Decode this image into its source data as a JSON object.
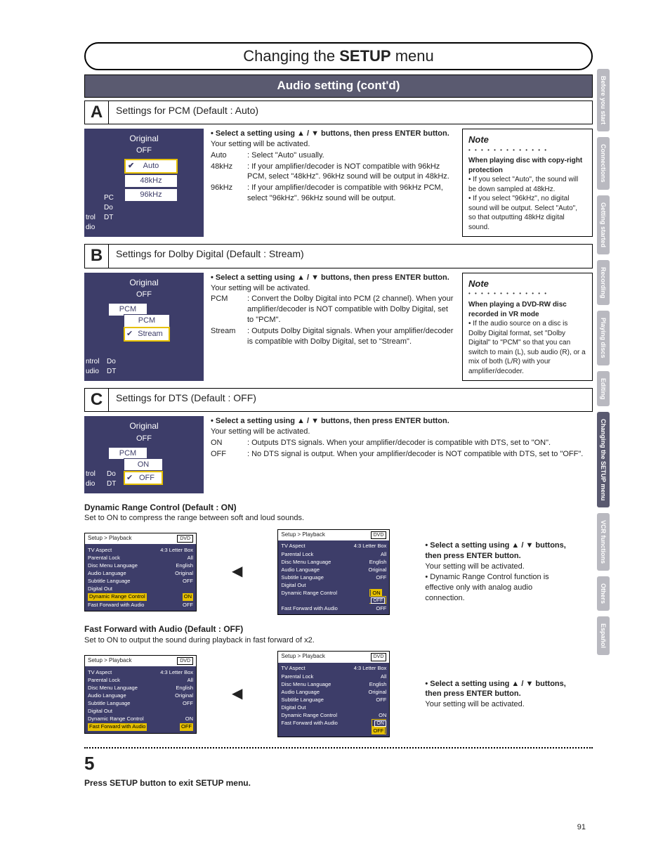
{
  "title_a": "Changing the ",
  "title_b": "SETUP",
  "title_c": " menu",
  "subtitle": "Audio setting (cont'd)",
  "sideTabs": [
    "Before you start",
    "Connections",
    "Getting started",
    "Recording",
    "Playing discs",
    "Editing",
    "Changing the SETUP menu",
    "VCR functions",
    "Others",
    "Español"
  ],
  "activeTab": "Changing the SETUP menu",
  "A": {
    "title": "Settings for PCM (Default : Auto)",
    "osd": {
      "hdr": "Original",
      "off": "OFF",
      "items": [
        "Auto",
        "48kHz",
        "96kHz"
      ],
      "selected": "Auto",
      "leftLabels": [
        "trol",
        "dio"
      ],
      "leftPrefix": [
        "PC",
        "Do",
        "DT"
      ]
    },
    "desc": {
      "lead": "• Select a setting using ▲ / ▼ buttons, then press ENTER button.",
      "line": "Your setting will be activated.",
      "opts": [
        {
          "l": "Auto",
          "t": ": Select \"Auto\" usually."
        },
        {
          "l": "48kHz",
          "t": ": If your amplifier/decoder is NOT compatible with 96kHz PCM, select \"48kHz\". 96kHz sound will be output in 48kHz."
        },
        {
          "l": "96kHz",
          "t": ": If your amplifier/decoder is compatible with 96kHz PCM, select \"96kHz\". 96kHz sound will be output."
        }
      ]
    },
    "note": {
      "h": "Note",
      "sub": "When playing disc with copy-right protection",
      "body": "• If you select \"Auto\", the sound will be down sampled at 48kHz.\n• If you select \"96kHz\", no digital sound will be output. Select \"Auto\", so that outputting 48kHz digital sound."
    }
  },
  "B": {
    "title": "Settings for Dolby Digital (Default : Stream)",
    "osd": {
      "hdr": "Original",
      "off": "OFF",
      "layer0": "PCM",
      "items": [
        "PCM",
        "Stream"
      ],
      "selected": "Stream",
      "leftLabels": [
        "ntrol",
        "udio"
      ],
      "leftPrefix": [
        "Do",
        "DT"
      ]
    },
    "desc": {
      "lead": "• Select a setting using ▲ / ▼ buttons, then press ENTER button.",
      "line": "Your setting will be activated.",
      "opts": [
        {
          "l": "PCM",
          "t": ": Convert the Dolby Digital into PCM (2 channel). When your amplifier/decoder is NOT compatible with Dolby Digital, set to \"PCM\"."
        },
        {
          "l": "Stream",
          "t": ": Outputs Dolby Digital signals. When your amplifier/decoder is compatible with Dolby Digital, set to \"Stream\"."
        }
      ]
    },
    "note": {
      "h": "Note",
      "sub": "When playing a DVD-RW disc recorded in VR mode",
      "body": "• If the audio source on a disc is Dolby Digital format, set \"Dolby Digital\" to \"PCM\" so that you can switch to main (L), sub audio (R), or a mix of both (L/R) with your amplifier/decoder."
    }
  },
  "C": {
    "title": "Settings for DTS (Default : OFF)",
    "osd": {
      "hdr": "Original",
      "off": "OFF",
      "layer0": "PCM",
      "items": [
        "ON",
        "OFF"
      ],
      "selected": "OFF",
      "leftLabels": [
        "trol",
        "dio"
      ],
      "leftPrefix": [
        "Do",
        "DT"
      ]
    },
    "desc": {
      "lead": "• Select a setting using ▲ / ▼ buttons, then press ENTER button.",
      "line": "Your setting will be activated.",
      "opts": [
        {
          "l": "ON",
          "t": ": Outputs DTS signals. When your amplifier/decoder is compatible with DTS, set to \"ON\"."
        },
        {
          "l": "OFF",
          "t": ": No DTS signal is output. When your amplifier/decoder is NOT compatible with DTS, set to \"OFF\"."
        }
      ]
    }
  },
  "drc": {
    "head": "Dynamic Range Control (Default : ON)",
    "sub": "Set to ON to compress the range between soft and loud sounds.",
    "menuPath": "Setup > Playback",
    "rows": [
      {
        "l": "TV Aspect",
        "v": "4:3 Letter Box"
      },
      {
        "l": "Parental Lock",
        "v": "All"
      },
      {
        "l": "Disc Menu Language",
        "v": "English"
      },
      {
        "l": "Audio Language",
        "v": "Original"
      },
      {
        "l": "Subtitle Language",
        "v": "OFF"
      },
      {
        "l": "Digital Out",
        "v": ""
      },
      {
        "l": "Dynamic Range Control",
        "v": "ON"
      },
      {
        "l": "Fast Forward with Audio",
        "v": "OFF"
      }
    ],
    "popup": [
      "ON",
      "OFF"
    ],
    "right": {
      "lead": "• Select a setting using ▲ / ▼ buttons, then press ENTER button.",
      "line": "Your setting will be activated.",
      "extra": "• Dynamic Range Control function is effective only with analog audio connection."
    }
  },
  "ffa": {
    "head": "Fast Forward with Audio (Default : OFF)",
    "sub": "Set to ON to output the sound during playback in fast forward of x2.",
    "right": {
      "lead": "• Select a setting using ▲ / ▼ buttons, then press ENTER button.",
      "line": "Your setting will be activated."
    }
  },
  "step": {
    "num": "5",
    "text": "Press SETUP button to exit SETUP menu."
  },
  "pageNum": "91",
  "dvdTag": "DVD"
}
